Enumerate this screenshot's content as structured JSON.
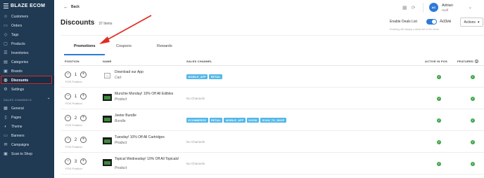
{
  "brand": {
    "name": "BLAZE ECOM"
  },
  "sidebar": {
    "items": [
      {
        "label": "Customers",
        "icon": "user-icon",
        "glyph": "☺"
      },
      {
        "label": "Orders",
        "icon": "orders-icon",
        "glyph": "▭"
      },
      {
        "label": "Tags",
        "icon": "tag-icon",
        "glyph": "◇"
      },
      {
        "label": "Products",
        "icon": "box-icon",
        "glyph": "▢"
      },
      {
        "label": "Inventories",
        "icon": "inventory-icon",
        "glyph": "☰"
      },
      {
        "label": "Categories",
        "icon": "categories-icon",
        "glyph": "▤"
      },
      {
        "label": "Brands",
        "icon": "brand-icon",
        "glyph": "▣"
      },
      {
        "label": "Discounts",
        "icon": "discount-icon",
        "glyph": "◎"
      },
      {
        "label": "Settings",
        "icon": "gear-icon",
        "glyph": "⚙"
      }
    ],
    "section_label": "SALES CHANNELS",
    "channel_items": [
      {
        "label": "General",
        "icon": "general-icon",
        "glyph": "▦"
      },
      {
        "label": "Pages",
        "icon": "pages-icon",
        "glyph": "▯"
      },
      {
        "label": "Theme",
        "icon": "theme-icon",
        "glyph": "◐"
      },
      {
        "label": "Banners",
        "icon": "banner-icon",
        "glyph": "▭"
      },
      {
        "label": "Campaigns",
        "icon": "campaign-icon",
        "glyph": "✉"
      },
      {
        "label": "Scan to Shop",
        "icon": "scan-icon",
        "glyph": "▣"
      }
    ]
  },
  "header": {
    "back_label": "Back",
    "user_initials": "AC",
    "user_name": "Adrian",
    "user_role": "Staff"
  },
  "page": {
    "title": "Discounts",
    "count": "37 Items",
    "deals_label": "Enable Deals List",
    "deals_hint": "Enabling will display a deals list in the menu",
    "toggle_label": "Active",
    "actions_label": "Actions"
  },
  "tabs": [
    "Promotions",
    "Coupons",
    "Rewards"
  ],
  "table": {
    "headers": {
      "position": "POSITION",
      "name": "NAME",
      "sales_channel": "SALES CHANNEL",
      "active_in_pos": "ACTIVE IN POS",
      "featured": "FEATURED"
    },
    "pos_label": "POS Position",
    "no_channels": "No Channels",
    "rows": [
      {
        "position": "1",
        "name": "Download our App",
        "type": "Cart",
        "channels": [
          "MOBILE_APP",
          "RETAIL"
        ]
      },
      {
        "position": "1",
        "name": "Munchie Monday! 10% Off All Edibles",
        "type": "Product",
        "channels": []
      },
      {
        "position": "2",
        "name": "Jeeter Bundle",
        "type": "Bundle",
        "channels": [
          "ECOMMERCE",
          "RETAIL",
          "MOBILE_APP",
          "KIOSK",
          "SCAN_TO_SHOP"
        ]
      },
      {
        "position": "2",
        "name": "Tuesday! 10% Off All Cartridges",
        "type": "Product",
        "channels": []
      },
      {
        "position": "3",
        "name": "Topical Wednesday! 10% Off All Topicals!",
        "type": "Product",
        "channels": []
      }
    ]
  },
  "colors": {
    "sidebar": "#1f3a52",
    "accent": "#2d7bd8",
    "chip": "#54b8e8",
    "check": "#3fa648",
    "annotation": "#e02b20"
  }
}
